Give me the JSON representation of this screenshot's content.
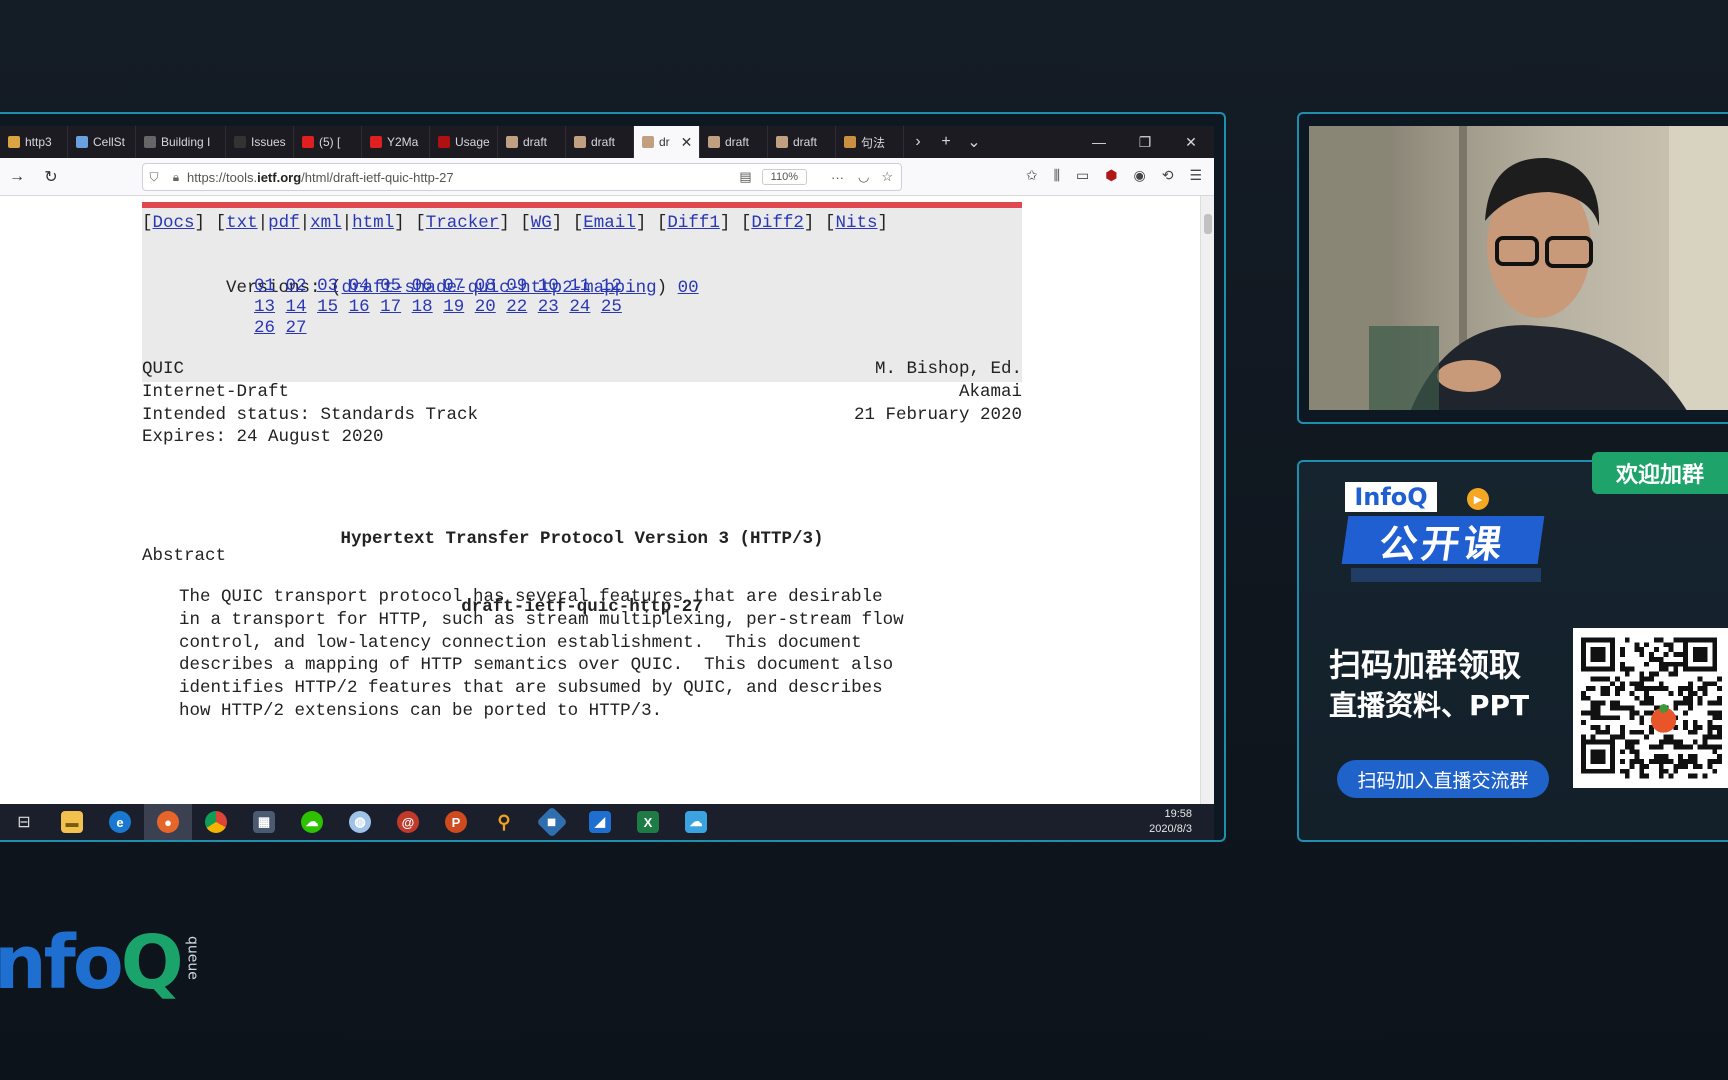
{
  "browser": {
    "tabs": [
      {
        "label": "http3",
        "color": "#d9a441"
      },
      {
        "label": "CellSt",
        "color": "#6aa0e0"
      },
      {
        "label": "Building I",
        "color": "#666666"
      },
      {
        "label": "Issues",
        "color": "#333333"
      },
      {
        "label": "(5) [",
        "color": "#e02020"
      },
      {
        "label": "Y2Ma",
        "color": "#e02020"
      },
      {
        "label": "Usage",
        "color": "#b01010"
      },
      {
        "label": "draft",
        "color": "#c0a080"
      },
      {
        "label": "draft",
        "color": "#c0a080"
      },
      {
        "label": "dr",
        "color": "#c0a080",
        "active": true
      },
      {
        "label": "draft",
        "color": "#c0a080"
      },
      {
        "label": "draft",
        "color": "#c0a080"
      },
      {
        "label": "句法",
        "color": "#c89040"
      }
    ],
    "url_prefix": "https://tools.",
    "url_domain": "ietf.org",
    "url_path": "/html/draft-ietf-quic-http-27",
    "zoom": "110%"
  },
  "doc": {
    "links": [
      "Docs",
      "txt",
      "pdf",
      "xml",
      "html",
      "Tracker",
      "WG",
      "Email",
      "Diff1",
      "Diff2",
      "Nits"
    ],
    "versions_label": "Versions:",
    "versions_draft": "draft-shade-quic-http2-mapping",
    "versions_row0": "00",
    "versions_rows": [
      [
        "01",
        "02",
        "03",
        "04",
        "05",
        "06",
        "07",
        "08",
        "09",
        "10",
        "11",
        "12"
      ],
      [
        "13",
        "14",
        "15",
        "16",
        "17",
        "18",
        "19",
        "20",
        "22",
        "23",
        "24",
        "25"
      ],
      [
        "26",
        "27"
      ]
    ],
    "header_left": [
      "QUIC",
      "Internet-Draft",
      "Intended status: Standards Track",
      "Expires: 24 August 2020"
    ],
    "header_right": [
      "M. Bishop, Ed.",
      "Akamai",
      "21 February 2020"
    ],
    "title_line1": "Hypertext Transfer Protocol Version 3 (HTTP/3)",
    "title_line2": "draft-ietf-quic-http-27",
    "abstract_heading": "Abstract",
    "abstract_lines": [
      "The QUIC transport protocol has several features that are desirable",
      "in a transport for HTTP, such as stream multiplexing, per-stream flow",
      "control, and low-latency connection establishment.  This document",
      "describes a mapping of HTTP semantics over QUIC.  This document also",
      "identifies HTTP/2 features that are subsumed by QUIC, and describes",
      "how HTTP/2 extensions can be ported to HTTP/3."
    ]
  },
  "taskbar": {
    "time": "19:58",
    "date": "2020/8/3"
  },
  "promo": {
    "welcome": "欢迎加群",
    "badge_brand": "InfoQ",
    "badge_course": "公开课",
    "line1": "扫码加群领取",
    "line2": "直播资料、PPT",
    "button": "扫码加入直播交流群"
  },
  "logo": {
    "main": "nfo",
    "q": "Q",
    "sub": "queue"
  }
}
